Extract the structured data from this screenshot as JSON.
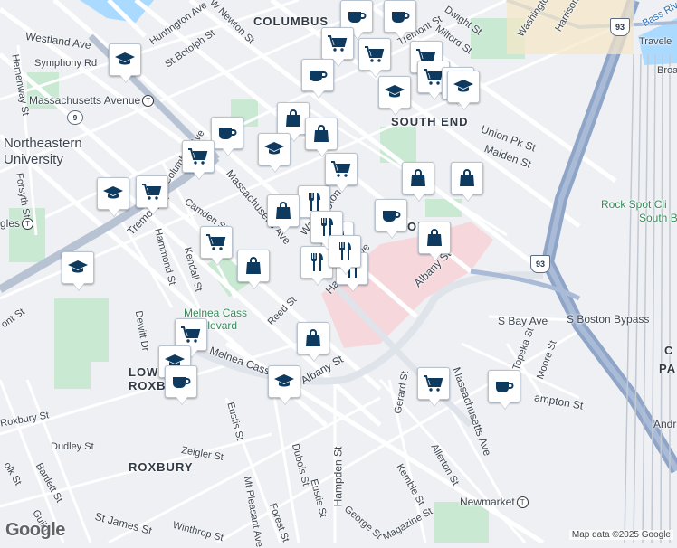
{
  "labels": {
    "columbus": "COLUMBUS",
    "south_end": "SOUTH END",
    "lower_roxbury_1": "LOWER",
    "lower_roxbury_2": "ROXBURY",
    "roxbury": "ROXBURY",
    "northeastern_1": "Northeastern",
    "northeastern_2": "University",
    "melnea_1": "Melnea Cass",
    "melnea_2": "Boulevard",
    "rock_spot_1": "Rock Spot Cli",
    "rock_spot_2": "South B",
    "newmarket": "Newmarket",
    "massachusetts_avenue_station": "Massachusetts Avenue",
    "of_fragment": "OF"
  },
  "streets": {
    "westland": "Westland Ave",
    "symphony": "Symphony Rd",
    "hemenway": "Hemenway St",
    "forsyth": "Forsyth St",
    "huntington": "Huntington Ave",
    "st_botolph": "St Botolph St",
    "newton": "W Newton St",
    "tremont_top": "Tremont St",
    "dwight": "Dwight St",
    "milford": "Milford St",
    "washington_top": "Washington",
    "harrison": "Harrison",
    "traveler": "Travele",
    "bass_river": "Bass Riv",
    "broad": "Broa",
    "columbus_ave": "Columbus Ave",
    "tremont_left": "Tremont St",
    "camden": "Camden St",
    "hammond": "Hammond St",
    "kendall": "Kendall St",
    "mass_ave": "Massachusetts Ave",
    "washington_mid": "Washington St",
    "union_pk": "Union Pk St",
    "malden": "Malden St",
    "harrison_mid": "Harrison Ave",
    "albany": "Albany St",
    "albany_low": "Albany St",
    "reed": "Reed St",
    "dewitt": "Dewitt Dr",
    "melnea": "Melnea Cass",
    "s_bay": "S Bay Ave",
    "s_boston_bypass": "S Boston Bypass",
    "topeka": "Topeka St",
    "moore": "Moore St",
    "hampton": "ampton St",
    "gerard": "Gerard St",
    "mass_ave_low": "Massachusetts Ave",
    "eustis": "Eustis St",
    "eustis2": "Eustis St",
    "roxbury_st": "Roxbury St",
    "dudley": "Dudley St",
    "zeigler": "Zeigler St",
    "bartlett": "Bartlett St",
    "dubois": "Dubois St",
    "hampden": "Hampden St",
    "mt_pleasant": "Mt Pleasant Ave",
    "forest": "Forest St",
    "george": "George St",
    "kemble": "Kemble St",
    "allerton": "Allerton St",
    "magazine": "Magazine St",
    "st_james": "St James St",
    "winthrop": "Winthrop St",
    "tolk": "olk St",
    "guild": "Guild",
    "ont": "ont St",
    "gles": "gles",
    "a93": "93",
    "b93": "93",
    "route9": "9",
    "right_c": "C",
    "right_pa": "PA",
    "right_andr": "Andr"
  },
  "attribution": "Map data ©2025 Google",
  "logo": "Google",
  "colors": {
    "pin_fill": "#ffffff",
    "icon": "#0d3a5e",
    "highway": "#8fa5c7",
    "park": "#c9e9d3",
    "hospital": "#f6d8dc",
    "water": "#aadaff"
  },
  "pins": [
    {
      "icon": "coffee-icon"
    },
    {
      "icon": "coffee-icon"
    },
    {
      "icon": "cart-icon"
    },
    {
      "icon": "cart-icon"
    },
    {
      "icon": "cart-icon"
    },
    {
      "icon": "cart-icon"
    },
    {
      "icon": "cart-icon"
    },
    {
      "icon": "graduation-cap-icon"
    },
    {
      "icon": "graduation-cap-icon"
    },
    {
      "icon": "coffee-icon"
    },
    {
      "icon": "bag-icon"
    },
    {
      "icon": "bag-icon"
    },
    {
      "icon": "coffee-icon"
    },
    {
      "icon": "graduation-cap-icon"
    },
    {
      "icon": "cart-icon"
    },
    {
      "icon": "graduation-cap-icon"
    },
    {
      "icon": "cart-icon"
    },
    {
      "icon": "graduation-cap-icon"
    },
    {
      "icon": "cart-icon"
    },
    {
      "icon": "restaurant-icon"
    },
    {
      "icon": "bag-icon"
    },
    {
      "icon": "restaurant-icon"
    },
    {
      "icon": "restaurant-icon"
    },
    {
      "icon": "restaurant-icon"
    },
    {
      "icon": "coffee-icon"
    },
    {
      "icon": "bag-icon"
    },
    {
      "icon": "bag-icon"
    },
    {
      "icon": "bag-icon"
    },
    {
      "icon": "cart-icon"
    },
    {
      "icon": "restaurant-icon"
    },
    {
      "icon": "restaurant-icon"
    },
    {
      "icon": "bag-icon"
    },
    {
      "icon": "graduation-cap-icon"
    },
    {
      "icon": "bag-icon"
    },
    {
      "icon": "cart-icon"
    },
    {
      "icon": "graduation-cap-icon"
    },
    {
      "icon": "coffee-icon"
    },
    {
      "icon": "graduation-cap-icon"
    },
    {
      "icon": "cart-icon"
    },
    {
      "icon": "coffee-icon"
    }
  ]
}
